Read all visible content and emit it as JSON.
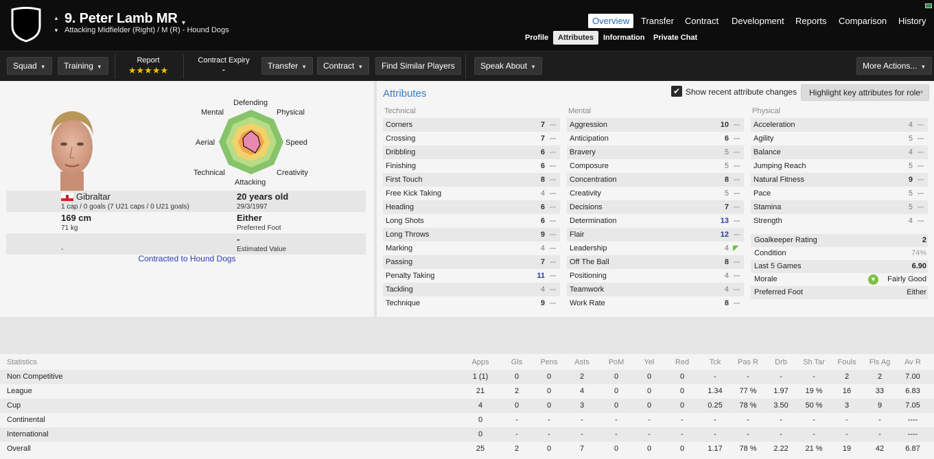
{
  "header": {
    "player_name": "9. Peter Lamb MR",
    "position_line": "Attacking Midfielder (Right) / M (R) - Hound Dogs",
    "main_tabs": [
      "Overview",
      "Transfer",
      "Contract",
      "Development",
      "Reports",
      "Comparison",
      "History"
    ],
    "active_main_tab": "Overview",
    "sub_tabs": [
      "Profile",
      "Attributes",
      "Information",
      "Private Chat"
    ],
    "active_sub_tab": "Attributes"
  },
  "toolbar": {
    "squad": "Squad",
    "training": "Training",
    "report_label": "Report",
    "report_stars": "★★★★★",
    "contract_expiry_label": "Contract Expiry",
    "contract_expiry_value": "-",
    "transfer": "Transfer",
    "contract": "Contract",
    "find_similar": "Find Similar Players",
    "speak_about": "Speak About",
    "more_actions": "More Actions..."
  },
  "profile": {
    "radar_labels": {
      "top": "Defending",
      "top_left": "Mental",
      "top_right": "Physical",
      "left": "Aerial",
      "right": "Speed",
      "bottom_left": "Technical",
      "bottom_right": "Creativity",
      "bottom": "Attacking"
    },
    "nationality": "Gibraltar",
    "caps": "1 cap / 0 goals (7 U21 caps / 0 U21 goals)",
    "age": "20 years old",
    "dob": "29/3/1997",
    "height": "169 cm",
    "weight": "71 kg",
    "preferred_foot": "Either",
    "preferred_foot_label": "Preferred Foot",
    "value_left": "-",
    "estimated_value": "-",
    "estimated_value_label": "Estimated Value",
    "contract_status": "Contracted to Hound Dogs"
  },
  "attributes": {
    "title": "Attributes",
    "show_recent_label": "Show recent attribute changes",
    "show_recent_checked": true,
    "highlight_button": "Highlight key attributes for role",
    "technical_label": "Technical",
    "mental_label": "Mental",
    "physical_label": "Physical",
    "technical": [
      {
        "name": "Corners",
        "value": "7"
      },
      {
        "name": "Crossing",
        "value": "7"
      },
      {
        "name": "Dribbling",
        "value": "6"
      },
      {
        "name": "Finishing",
        "value": "6"
      },
      {
        "name": "First Touch",
        "value": "8"
      },
      {
        "name": "Free Kick Taking",
        "value": "4"
      },
      {
        "name": "Heading",
        "value": "6"
      },
      {
        "name": "Long Shots",
        "value": "6"
      },
      {
        "name": "Long Throws",
        "value": "9"
      },
      {
        "name": "Marking",
        "value": "4"
      },
      {
        "name": "Passing",
        "value": "7"
      },
      {
        "name": "Penalty Taking",
        "value": "11"
      },
      {
        "name": "Tackling",
        "value": "4"
      },
      {
        "name": "Technique",
        "value": "9"
      }
    ],
    "mental": [
      {
        "name": "Aggression",
        "value": "10"
      },
      {
        "name": "Anticipation",
        "value": "6"
      },
      {
        "name": "Bravery",
        "value": "5"
      },
      {
        "name": "Composure",
        "value": "5"
      },
      {
        "name": "Concentration",
        "value": "8"
      },
      {
        "name": "Creativity",
        "value": "5"
      },
      {
        "name": "Decisions",
        "value": "7"
      },
      {
        "name": "Determination",
        "value": "13"
      },
      {
        "name": "Flair",
        "value": "12"
      },
      {
        "name": "Leadership",
        "value": "4"
      },
      {
        "name": "Off The Ball",
        "value": "8"
      },
      {
        "name": "Positioning",
        "value": "4"
      },
      {
        "name": "Teamwork",
        "value": "4"
      },
      {
        "name": "Work Rate",
        "value": "8"
      }
    ],
    "physical": [
      {
        "name": "Acceleration",
        "value": "4"
      },
      {
        "name": "Agility",
        "value": "5"
      },
      {
        "name": "Balance",
        "value": "4"
      },
      {
        "name": "Jumping Reach",
        "value": "5"
      },
      {
        "name": "Natural Fitness",
        "value": "9"
      },
      {
        "name": "Pace",
        "value": "5"
      },
      {
        "name": "Stamina",
        "value": "5"
      },
      {
        "name": "Strength",
        "value": "4"
      }
    ],
    "extra": [
      {
        "name": "Goalkeeper Rating",
        "value": "2"
      },
      {
        "name": "Condition",
        "value": "74%"
      },
      {
        "name": "Last 5 Games",
        "value": "6.90"
      },
      {
        "name": "Morale",
        "value": "Fairly Good"
      },
      {
        "name": "Preferred Foot",
        "value": "Either"
      }
    ]
  },
  "statistics": {
    "headers": [
      "Statistics",
      "Apps",
      "Gls",
      "Pens",
      "Asts",
      "PoM",
      "Yel",
      "Red",
      "Tck",
      "Pas R",
      "Drb",
      "Sh Tar",
      "Fouls",
      "Fls Ag",
      "Av R"
    ],
    "rows": [
      [
        "Non Competitive",
        "1 (1)",
        "0",
        "0",
        "2",
        "0",
        "0",
        "0",
        "-",
        "-",
        "-",
        "-",
        "2",
        "2",
        "7.00"
      ],
      [
        "League",
        "21",
        "2",
        "0",
        "4",
        "0",
        "0",
        "0",
        "1.34",
        "77 %",
        "1.97",
        "19 %",
        "16",
        "33",
        "6.83"
      ],
      [
        "Cup",
        "4",
        "0",
        "0",
        "3",
        "0",
        "0",
        "0",
        "0.25",
        "78 %",
        "3.50",
        "50 %",
        "3",
        "9",
        "7.05"
      ],
      [
        "Continental",
        "0",
        "-",
        "-",
        "-",
        "-",
        "-",
        "-",
        "-",
        "-",
        "-",
        "-",
        "-",
        "-",
        "----"
      ],
      [
        "International",
        "0",
        "-",
        "-",
        "-",
        "-",
        "-",
        "-",
        "-",
        "-",
        "-",
        "-",
        "-",
        "-",
        "----"
      ],
      [
        "Overall",
        "25",
        "2",
        "0",
        "7",
        "0",
        "0",
        "0",
        "1.17",
        "78 %",
        "2.22",
        "21 %",
        "19",
        "42",
        "6.87"
      ]
    ]
  },
  "colors": {
    "accent": "#3b79c4",
    "header_bg": "#0d0d0d",
    "toolbar_bg": "#1d1d1d",
    "highlight_value": "#1d3f96",
    "morale_green": "#7cc242"
  }
}
